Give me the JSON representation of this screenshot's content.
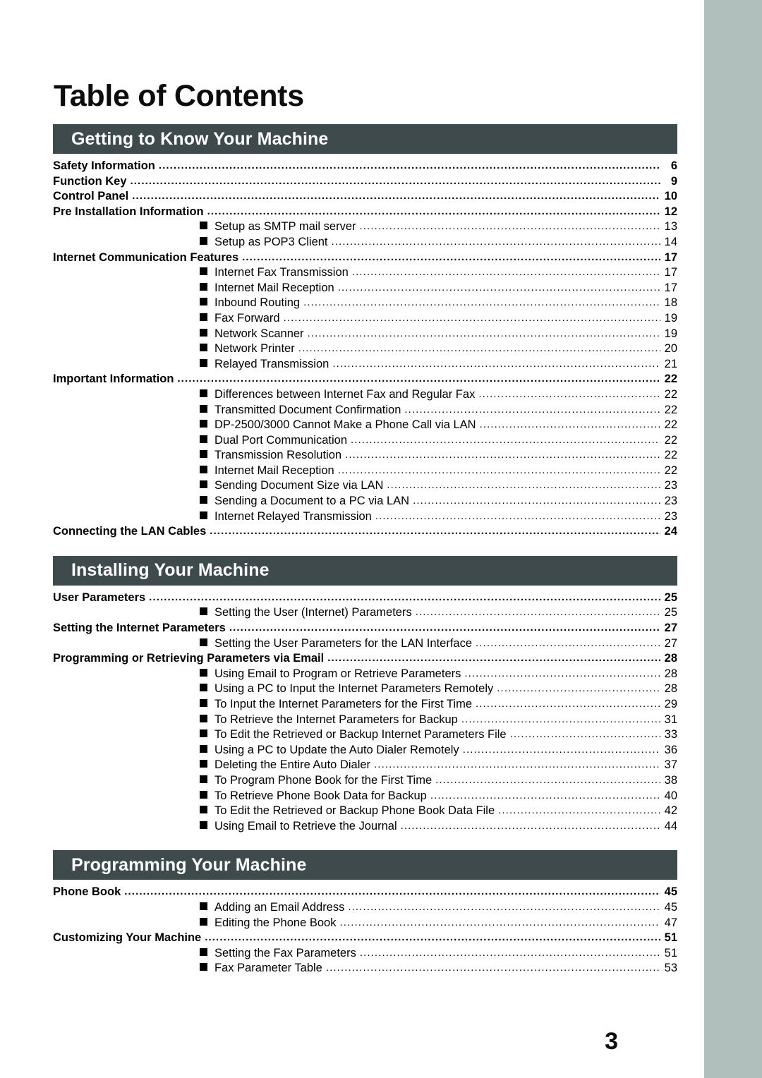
{
  "document": {
    "title": "Table of Contents",
    "page_number": "3",
    "accent_bar_color": "#3e4a4b",
    "edge_bar_color": "#b1bfbc"
  },
  "sections": [
    {
      "title": "Getting to Know Your Machine",
      "entries": [
        {
          "level": 1,
          "label": "Safety Information",
          "page": "6"
        },
        {
          "level": 1,
          "label": "Function Key",
          "page": "9"
        },
        {
          "level": 1,
          "label": "Control Panel",
          "page": "10"
        },
        {
          "level": 1,
          "label": "Pre Installation Information",
          "page": "12"
        },
        {
          "level": 2,
          "label": "Setup as SMTP mail server",
          "page": "13"
        },
        {
          "level": 2,
          "label": "Setup as POP3 Client",
          "page": "14"
        },
        {
          "level": 1,
          "label": "Internet Communication Features",
          "page": "17"
        },
        {
          "level": 2,
          "label": "Internet Fax Transmission",
          "page": "17"
        },
        {
          "level": 2,
          "label": "Internet Mail Reception",
          "page": "17"
        },
        {
          "level": 2,
          "label": "Inbound Routing",
          "page": "18"
        },
        {
          "level": 2,
          "label": "Fax Forward",
          "page": "19"
        },
        {
          "level": 2,
          "label": "Network Scanner",
          "page": "19"
        },
        {
          "level": 2,
          "label": "Network Printer",
          "page": "20"
        },
        {
          "level": 2,
          "label": "Relayed Transmission",
          "page": "21"
        },
        {
          "level": 1,
          "label": "Important Information",
          "page": "22"
        },
        {
          "level": 2,
          "label": "Differences between Internet Fax and Regular Fax",
          "page": "22"
        },
        {
          "level": 2,
          "label": "Transmitted Document Confirmation",
          "page": "22"
        },
        {
          "level": 2,
          "label": "DP-2500/3000 Cannot Make a Phone Call via LAN",
          "page": "22"
        },
        {
          "level": 2,
          "label": "Dual Port Communication",
          "page": "22"
        },
        {
          "level": 2,
          "label": "Transmission Resolution",
          "page": "22"
        },
        {
          "level": 2,
          "label": "Internet Mail Reception",
          "page": "22"
        },
        {
          "level": 2,
          "label": "Sending Document Size via LAN",
          "page": "23"
        },
        {
          "level": 2,
          "label": "Sending a Document to a PC via LAN",
          "page": "23"
        },
        {
          "level": 2,
          "label": "Internet Relayed Transmission",
          "page": "23"
        },
        {
          "level": 1,
          "label": "Connecting the LAN Cables",
          "page": "24"
        }
      ]
    },
    {
      "title": "Installing Your Machine",
      "entries": [
        {
          "level": 1,
          "label": "User Parameters",
          "page": "25"
        },
        {
          "level": 2,
          "label": "Setting the User (Internet) Parameters",
          "page": "25"
        },
        {
          "level": 1,
          "label": "Setting the Internet Parameters",
          "page": "27"
        },
        {
          "level": 2,
          "label": "Setting the User Parameters for the LAN Interface",
          "page": "27"
        },
        {
          "level": 1,
          "label": "Programming or Retrieving Parameters via Email",
          "page": "28"
        },
        {
          "level": 2,
          "label": "Using Email to Program or Retrieve Parameters",
          "page": "28"
        },
        {
          "level": 2,
          "label": "Using a PC to Input the Internet Parameters Remotely",
          "page": "28"
        },
        {
          "level": 2,
          "label": "To Input the Internet Parameters for the First Time",
          "page": "29"
        },
        {
          "level": 2,
          "label": "To Retrieve the Internet Parameters for Backup",
          "page": "31"
        },
        {
          "level": 2,
          "label": "To Edit the Retrieved or Backup Internet Parameters File",
          "page": "33"
        },
        {
          "level": 2,
          "label": "Using a PC to Update the Auto Dialer Remotely",
          "page": "36"
        },
        {
          "level": 2,
          "label": "Deleting the Entire Auto Dialer",
          "page": "37"
        },
        {
          "level": 2,
          "label": "To Program Phone Book for the First Time",
          "page": "38"
        },
        {
          "level": 2,
          "label": "To Retrieve Phone Book Data for Backup",
          "page": "40"
        },
        {
          "level": 2,
          "label": "To Edit the Retrieved or Backup Phone Book Data File",
          "page": "42"
        },
        {
          "level": 2,
          "label": "Using Email to Retrieve the Journal",
          "page": "44"
        }
      ]
    },
    {
      "title": "Programming Your Machine",
      "entries": [
        {
          "level": 1,
          "label": "Phone Book",
          "page": "45"
        },
        {
          "level": 2,
          "label": "Adding an Email Address",
          "page": "45"
        },
        {
          "level": 2,
          "label": "Editing the Phone Book",
          "page": "47"
        },
        {
          "level": 1,
          "label": "Customizing Your Machine",
          "page": "51"
        },
        {
          "level": 2,
          "label": "Setting the Fax Parameters",
          "page": "51"
        },
        {
          "level": 2,
          "label": "Fax Parameter Table",
          "page": "53"
        }
      ]
    }
  ]
}
